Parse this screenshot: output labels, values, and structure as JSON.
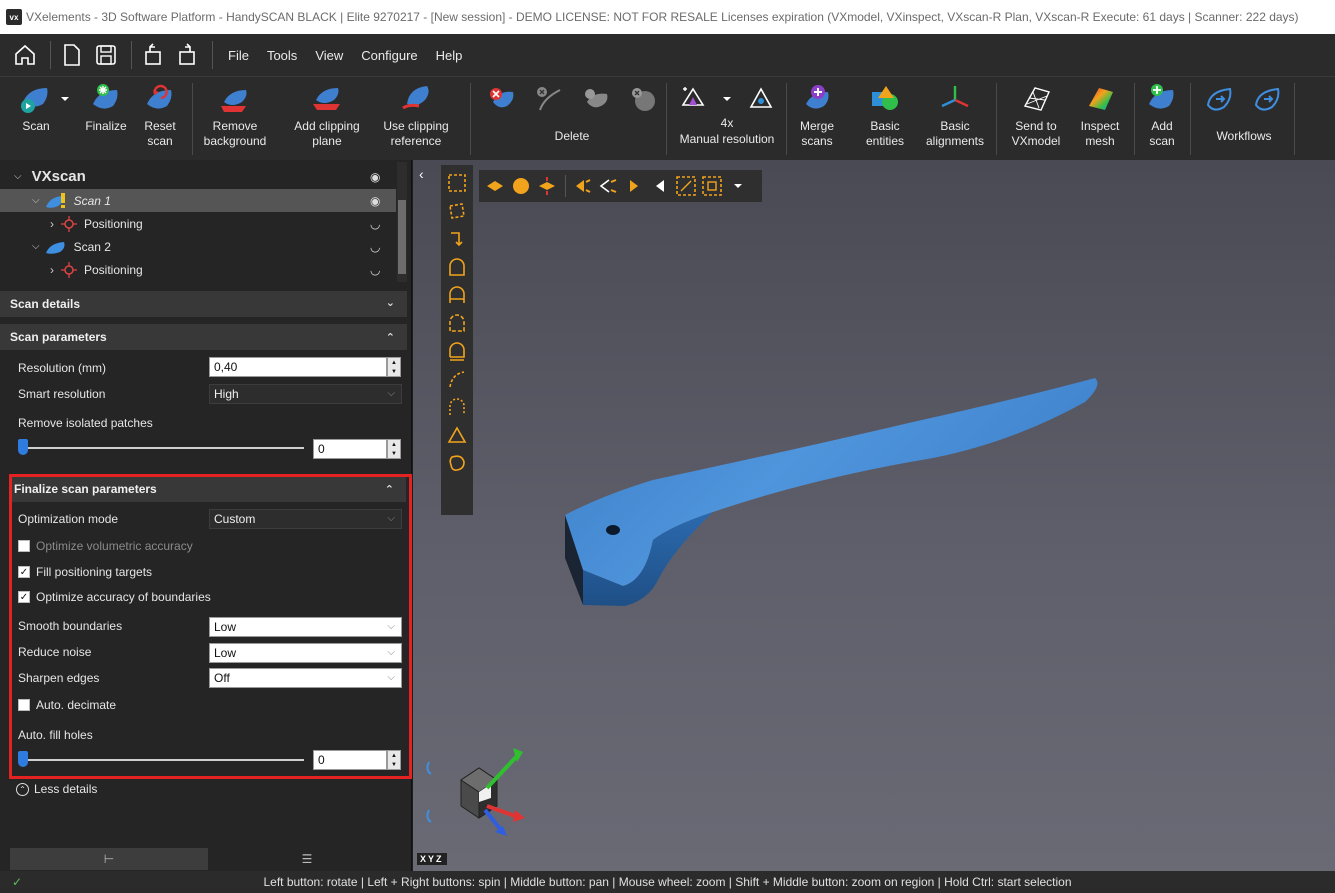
{
  "window": {
    "logo": "vx",
    "title": "VXelements - 3D Software Platform - HandySCAN BLACK | Elite 9270217 - [New session] - DEMO LICENSE: NOT FOR RESALE Licenses expiration (VXmodel, VXinspect, VXscan-R Plan, VXscan-R Execute: 61 days | Scanner: 222 days)"
  },
  "menu": {
    "items": [
      "File",
      "Tools",
      "View",
      "Configure",
      "Help"
    ],
    "quick_icons": [
      "home-icon",
      "new-file-icon",
      "save-icon",
      "undo-icon",
      "redo-icon"
    ]
  },
  "ribbon": {
    "buttons": [
      {
        "label": "Scan",
        "icon": "scan-icon"
      },
      {
        "label": "Finalize",
        "icon": "finalize-icon"
      },
      {
        "label": "Reset\nscan",
        "icon": "reset-scan-icon"
      },
      {
        "label": "Remove\nbackground",
        "icon": "remove-background-icon"
      },
      {
        "label": "Add clipping\nplane",
        "icon": "clipping-plane-icon"
      },
      {
        "label": "Use clipping\nreference",
        "icon": "clipping-reference-icon"
      },
      {
        "label": "Delete",
        "icon": "delete-icon"
      },
      {
        "label": "Manual resolution",
        "icon": "resolution-icon",
        "value": "4x"
      },
      {
        "label": "Merge\nscans",
        "icon": "merge-icon"
      },
      {
        "label": "Basic\nentities",
        "icon": "entities-icon"
      },
      {
        "label": "Basic\nalignments",
        "icon": "alignments-icon"
      },
      {
        "label": "Send to\nVXmodel",
        "icon": "vxmodel-icon"
      },
      {
        "label": "Inspect\nmesh",
        "icon": "inspect-mesh-icon"
      },
      {
        "label": "Add\nscan",
        "icon": "add-scan-icon"
      },
      {
        "label": "Workflows",
        "icon": "workflows-icon"
      }
    ]
  },
  "tree": {
    "root": "VXscan",
    "items": [
      {
        "label": "Scan 1",
        "selected": true
      },
      {
        "label": "Positioning"
      },
      {
        "label": "Scan 2"
      },
      {
        "label": "Positioning"
      }
    ]
  },
  "sections": {
    "scan_details": "Scan details",
    "scan_parameters": "Scan parameters",
    "finalize": "Finalize scan parameters",
    "less_details": "Less details"
  },
  "scan_params": {
    "resolution_label": "Resolution (mm)",
    "resolution_value": "0,40",
    "smart_resolution_label": "Smart resolution",
    "smart_resolution_value": "High",
    "remove_patches_label": "Remove isolated patches",
    "remove_patches_value": "0",
    "remove_patches_level": 0
  },
  "finalize_params": {
    "optimization_mode_label": "Optimization mode",
    "optimization_mode_value": "Custom",
    "optimize_volumetric": {
      "label": "Optimize volumetric accuracy",
      "checked": false,
      "enabled": false
    },
    "fill_targets": {
      "label": "Fill positioning targets",
      "checked": true
    },
    "optimize_boundaries": {
      "label": "Optimize accuracy of boundaries",
      "checked": true
    },
    "smooth_boundaries_label": "Smooth boundaries",
    "smooth_boundaries_value": "Low",
    "reduce_noise_label": "Reduce noise",
    "reduce_noise_value": "Low",
    "sharpen_edges_label": "Sharpen edges",
    "sharpen_edges_value": "Off",
    "auto_decimate": {
      "label": "Auto. decimate",
      "checked": false
    },
    "auto_fill_label": "Auto. fill holes",
    "auto_fill_value": "0",
    "auto_fill_level": 0
  },
  "axis_label": "XYZ",
  "status": "Left button: rotate  |  Left + Right buttons: spin  |  Middle button: pan  |  Mouse wheel: zoom  |  Shift + Middle button: zoom on region  |  Hold Ctrl: start selection",
  "colors": {
    "accent_blue": "#3f7fd0",
    "highlight_red": "#e52222",
    "tool_orange": "#f2a31c"
  }
}
